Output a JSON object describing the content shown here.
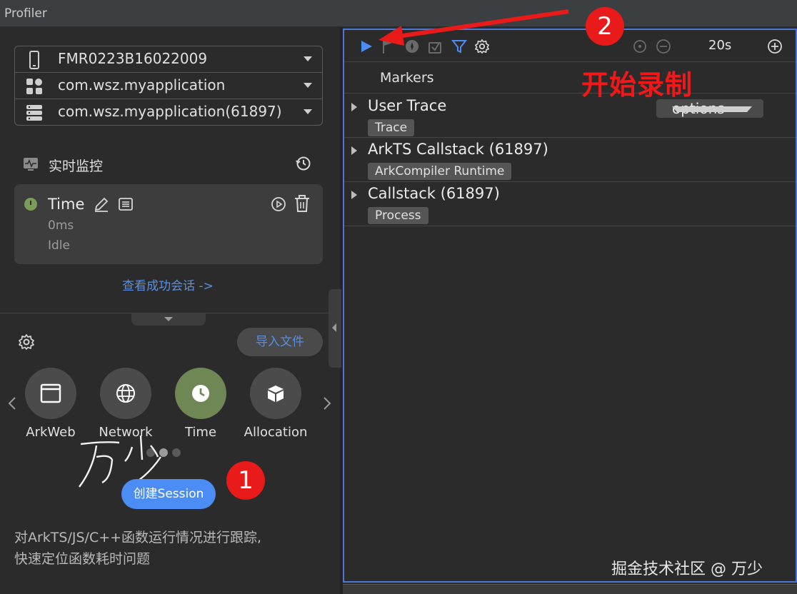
{
  "window": {
    "title": "Profiler"
  },
  "device_selector": {
    "device": "FMR0223B16022009",
    "application": "com.wsz.myapplication",
    "process": "com.wsz.myapplication(61897)"
  },
  "monitor": {
    "title": "实时监控"
  },
  "session": {
    "name": "Time",
    "duration": "0ms",
    "status": "Idle"
  },
  "view_sessions_link": "查看成功会话 ->",
  "import_button": "导入文件",
  "tools": [
    {
      "label": "ArkWeb",
      "icon": "browser-window-icon"
    },
    {
      "label": "Network",
      "icon": "globe-icon"
    },
    {
      "label": "Time",
      "icon": "clock-icon"
    },
    {
      "label": "Allocation",
      "icon": "cube-icon"
    }
  ],
  "create_session_button": "创建Session",
  "description_line1": "对ArkTS/JS/C++函数运行情况进行跟踪,",
  "description_line2": "快速定位函数耗时问题",
  "toolbar": {
    "duration": "20s"
  },
  "timeline": {
    "markers_label": "Markers",
    "options_label": "options",
    "tracks": [
      {
        "name": "User Trace",
        "chip": "Trace"
      },
      {
        "name": "ArkTS Callstack (61897)",
        "chip": "ArkCompiler Runtime"
      },
      {
        "name": "Callstack (61897)",
        "chip": "Process"
      }
    ]
  },
  "annotations": {
    "step1": "1",
    "step2": "2",
    "start_recording": "开始录制",
    "accent_color": "#e81a1a"
  },
  "watermark": "掘金技术社区 @ 万少",
  "colors": {
    "accent_blue": "#4c8cf5",
    "link_blue": "#5a8fe0",
    "active_tool": "#6e8754",
    "panel_border": "#4a78d6"
  }
}
